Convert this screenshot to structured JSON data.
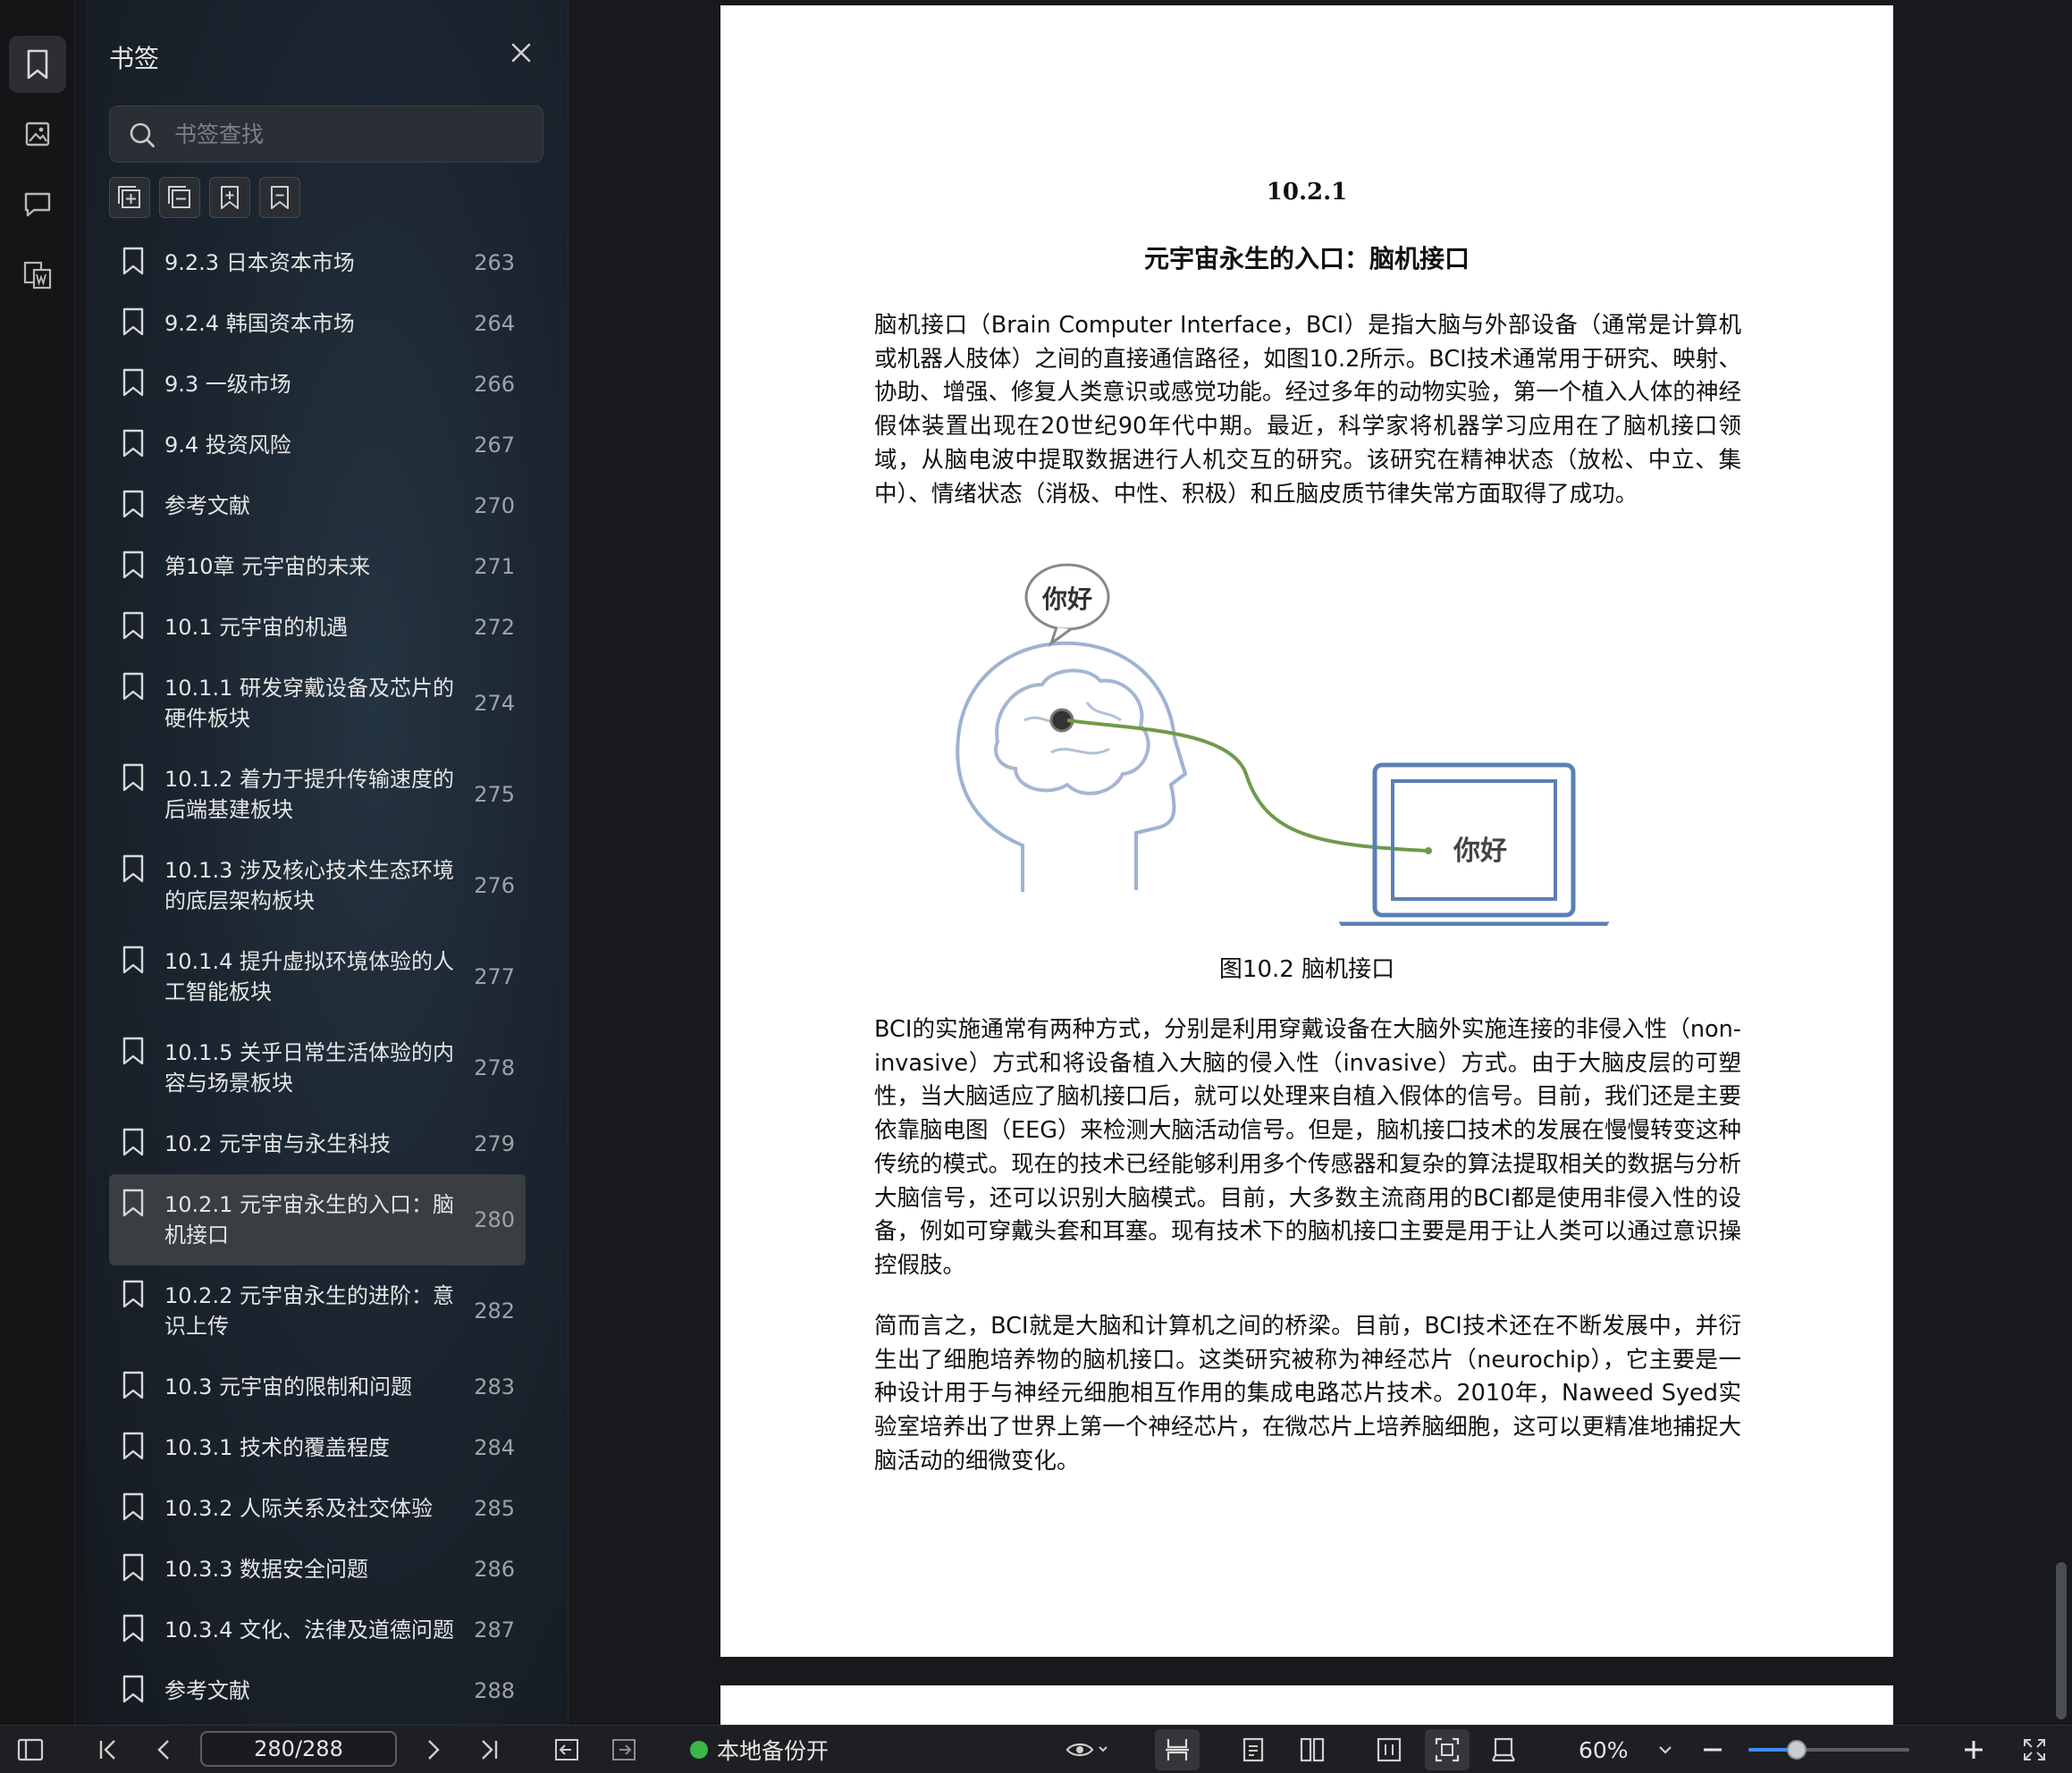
{
  "sidebar": {
    "title": "书签",
    "search_placeholder": "书签查找",
    "items": [
      {
        "label": "9.2.3 日本资本市场",
        "page": "263"
      },
      {
        "label": "9.2.4 韩国资本市场",
        "page": "264"
      },
      {
        "label": "9.3 一级市场",
        "page": "266"
      },
      {
        "label": "9.4 投资风险",
        "page": "267"
      },
      {
        "label": "参考文献",
        "page": "270"
      },
      {
        "label": "第10章 元宇宙的未来",
        "page": "271"
      },
      {
        "label": "10.1 元宇宙的机遇",
        "page": "272"
      },
      {
        "label": "10.1.1 研发穿戴设备及芯片的硬件板块",
        "page": "274"
      },
      {
        "label": "10.1.2 着力于提升传输速度的后端基建板块",
        "page": "275"
      },
      {
        "label": "10.1.3 涉及核心技术生态环境的底层架构板块",
        "page": "276"
      },
      {
        "label": "10.1.4 提升虚拟环境体验的人工智能板块",
        "page": "277"
      },
      {
        "label": "10.1.5 关乎日常生活体验的内容与场景板块",
        "page": "278"
      },
      {
        "label": "10.2 元宇宙与永生科技",
        "page": "279"
      },
      {
        "label": "10.2.1 元宇宙永生的入口：脑机接口",
        "page": "280"
      },
      {
        "label": "10.2.2 元宇宙永生的进阶：意识上传",
        "page": "282"
      },
      {
        "label": "10.3 元宇宙的限制和问题",
        "page": "283"
      },
      {
        "label": "10.3.1 技术的覆盖程度",
        "page": "284"
      },
      {
        "label": "10.3.2 人际关系及社交体验",
        "page": "285"
      },
      {
        "label": "10.3.3 数据安全问题",
        "page": "286"
      },
      {
        "label": "10.3.4 文化、法律及道德问题",
        "page": "287"
      },
      {
        "label": "参考文献",
        "page": "288"
      }
    ],
    "selected_index": 13
  },
  "document": {
    "section_number": "10.2.1",
    "section_title": "元宇宙永生的入口：脑机接口",
    "paragraph1": "脑机接口（Brain Computer Interface，BCI）是指大脑与外部设备（通常是计算机或机器人肢体）之间的直接通信路径，如图10.2所示。BCI技术通常用于研究、映射、协助、增强、修复人类意识或感觉功能。经过多年的动物实验，第一个植入人体的神经假体装置出现在20世纪90年代中期。最近，科学家将机器学习应用在了脑机接口领域，从脑电波中提取数据进行人机交互的研究。该研究在精神状态（放松、中立、集中）、情绪状态（消极、中性、积极）和丘脑皮质节律失常方面取得了成功。",
    "figure_bubble_text": "你好",
    "figure_screen_text": "你好",
    "figure_caption": "图10.2 脑机接口",
    "paragraph2": "BCI的实施通常有两种方式，分别是利用穿戴设备在大脑外实施连接的非侵入性（non-invasive）方式和将设备植入大脑的侵入性（invasive）方式。由于大脑皮层的可塑性，当大脑适应了脑机接口后，就可以处理来自植入假体的信号。目前，我们还是主要依靠脑电图（EEG）来检测大脑活动信号。但是，脑机接口技术的发展在慢慢转变这种传统的模式。现在的技术已经能够利用多个传感器和复杂的算法提取相关的数据与分析大脑信号，还可以识别大脑模式。目前，大多数主流商用的BCI都是使用非侵入性的设备，例如可穿戴头套和耳塞。现有技术下的脑机接口主要是用于让人类可以通过意识操控假肢。",
    "paragraph3": "简而言之，BCI就是大脑和计算机之间的桥梁。目前，BCI技术还在不断发展中，并衍生出了细胞培养物的脑机接口。这类研究被称为神经芯片（neurochip），它主要是一种设计用于与神经元细胞相互作用的集成电路芯片技术。2010年，Naweed Syed实验室培养出了世界上第一个神经芯片，在微芯片上培养脑细胞，这可以更精准地捕捉大脑活动的细微变化。"
  },
  "bottombar": {
    "page_indicator": "280/288",
    "backup_status": "本地备份开",
    "zoom": "60%",
    "zoom_fraction": 0.3
  },
  "colors": {
    "accent": "#3d8bfd",
    "status_green": "#3bb54a",
    "figure_line": "#6f9a4a",
    "figure_blue": "#5b7fb5"
  },
  "icons": {
    "rail": [
      "bookmark-icon",
      "image-icon",
      "comment-icon",
      "word-convert-icon"
    ],
    "tools": [
      "expand-all-icon",
      "collapse-all-icon",
      "add-bookmark-icon",
      "remove-bookmark-icon"
    ]
  }
}
